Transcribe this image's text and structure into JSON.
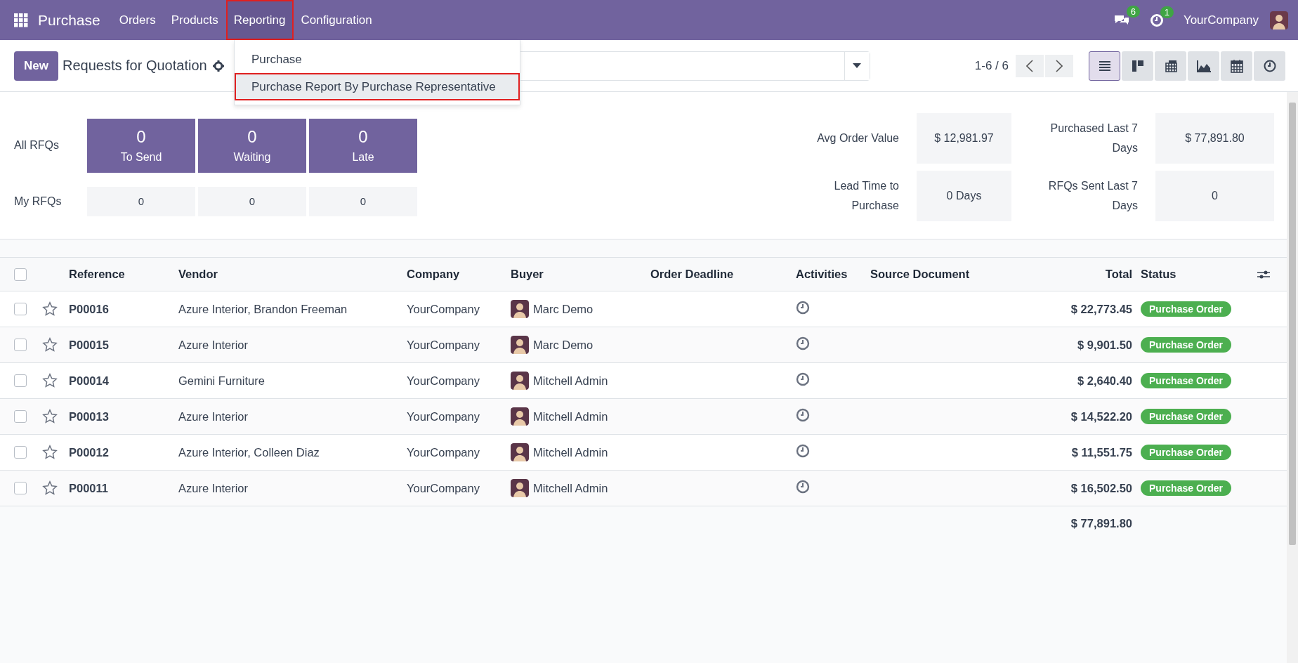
{
  "navbar": {
    "app": "Purchase",
    "menu": [
      {
        "label": "Orders",
        "selected": false
      },
      {
        "label": "Products",
        "selected": false
      },
      {
        "label": "Reporting",
        "selected": true
      },
      {
        "label": "Configuration",
        "selected": false
      }
    ],
    "messages_count": "6",
    "activities_count": "1",
    "company": "YourCompany"
  },
  "reporting_menu": {
    "items": [
      {
        "label": "Purchase",
        "selected": false
      },
      {
        "label": "Purchase Report By Purchase Representative",
        "selected": true
      }
    ]
  },
  "control_panel": {
    "new_button": "New",
    "title": "Requests for Quotation",
    "pager": "1-6 / 6",
    "views": [
      {
        "kind": "list",
        "selected": true
      },
      {
        "kind": "kanban",
        "selected": false
      },
      {
        "kind": "pivot",
        "selected": false
      },
      {
        "kind": "graph",
        "selected": false
      },
      {
        "kind": "calendar",
        "selected": false
      },
      {
        "kind": "activity",
        "selected": false
      }
    ]
  },
  "dashboard": {
    "all_label": "All RFQs",
    "my_label": "My RFQs",
    "tiles": [
      {
        "count": "0",
        "label": "To Send",
        "mine": "0"
      },
      {
        "count": "0",
        "label": "Waiting",
        "mine": "0"
      },
      {
        "count": "0",
        "label": "Late",
        "mine": "0"
      }
    ],
    "stats": [
      {
        "label": "Avg Order Value",
        "value": "$ 12,981.97"
      },
      {
        "label": "Purchased Last 7 Days",
        "value": "$ 77,891.80"
      },
      {
        "label": "Lead Time to Purchase",
        "value": "0 Days"
      },
      {
        "label": "RFQs Sent Last 7 Days",
        "value": "0"
      }
    ]
  },
  "table": {
    "columns": [
      "Reference",
      "Vendor",
      "Company",
      "Buyer",
      "Order Deadline",
      "Activities",
      "Source Document",
      "Total",
      "Status"
    ],
    "all_checked": false,
    "rows": [
      {
        "checked": false,
        "starred": false,
        "reference": "P00016",
        "vendor": "Azure Interior, Brandon Freeman",
        "company": "YourCompany",
        "buyer": "Marc Demo",
        "total": "$ 22,773.45",
        "status": "Purchase Order"
      },
      {
        "checked": false,
        "starred": false,
        "reference": "P00015",
        "vendor": "Azure Interior",
        "company": "YourCompany",
        "buyer": "Marc Demo",
        "total": "$ 9,901.50",
        "status": "Purchase Order"
      },
      {
        "checked": false,
        "starred": false,
        "reference": "P00014",
        "vendor": "Gemini Furniture",
        "company": "YourCompany",
        "buyer": "Mitchell Admin",
        "total": "$ 2,640.40",
        "status": "Purchase Order"
      },
      {
        "checked": false,
        "starred": false,
        "reference": "P00013",
        "vendor": "Azure Interior",
        "company": "YourCompany",
        "buyer": "Mitchell Admin",
        "total": "$ 14,522.20",
        "status": "Purchase Order"
      },
      {
        "checked": false,
        "starred": false,
        "reference": "P00012",
        "vendor": "Azure Interior, Colleen Diaz",
        "company": "YourCompany",
        "buyer": "Mitchell Admin",
        "total": "$ 11,551.75",
        "status": "Purchase Order"
      },
      {
        "checked": false,
        "starred": false,
        "reference": "P00011",
        "vendor": "Azure Interior",
        "company": "YourCompany",
        "buyer": "Mitchell Admin",
        "total": "$ 16,502.50",
        "status": "Purchase Order"
      }
    ],
    "grand_total": "$ 77,891.80"
  }
}
